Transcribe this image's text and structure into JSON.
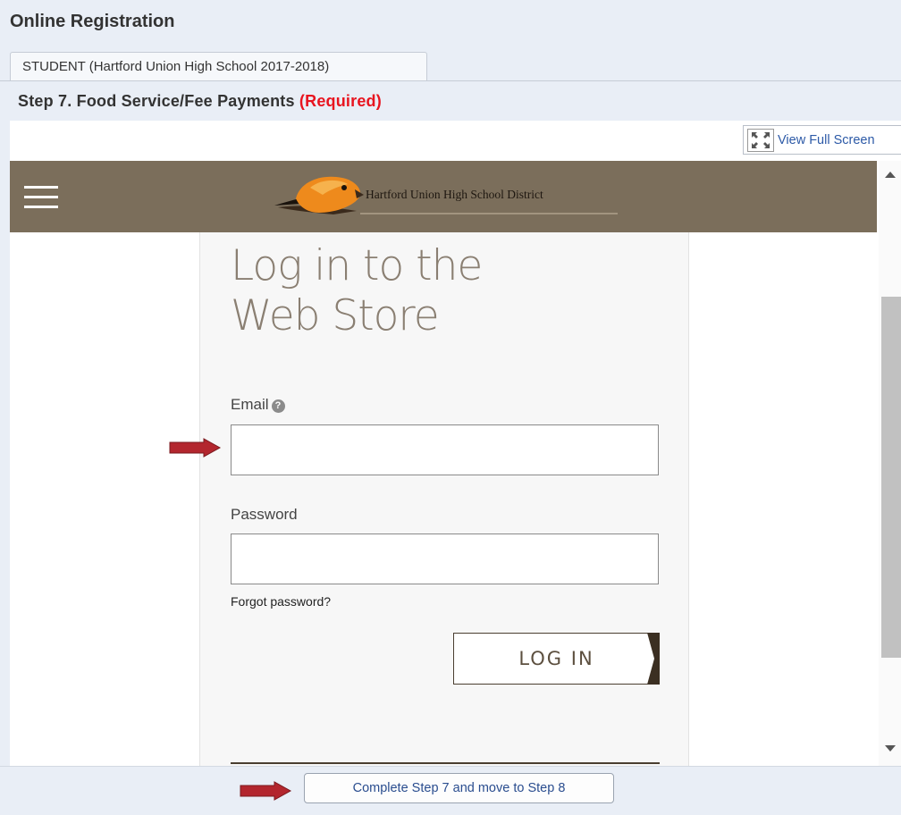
{
  "app": {
    "title": "Online Registration"
  },
  "tab": {
    "label": "STUDENT (Hartford Union High School 2017-2018)"
  },
  "step": {
    "title": "Step 7. Food Service/Fee Payments",
    "required": "(Required)"
  },
  "toolbar": {
    "fullscreen_label": "View Full Screen"
  },
  "store": {
    "school_name": "Hartford Union High School District",
    "heading_line1": "Log in to the",
    "heading_line2": "Web Store",
    "email_label": "Email",
    "password_label": "Password",
    "forgot_label": "Forgot password?",
    "login_label": "LOG IN"
  },
  "footer": {
    "complete_label": "Complete Step 7 and move to Step 8"
  },
  "colors": {
    "header_brown": "#7b6e5b",
    "heading_taupe": "#8a7f72",
    "required_red": "#e8141f",
    "annotation_arrow": "#b3262e",
    "link_blue": "#2d5aa7"
  },
  "icons": [
    "hamburger-menu-icon",
    "expand-icon",
    "help-icon",
    "hawk-logo"
  ]
}
